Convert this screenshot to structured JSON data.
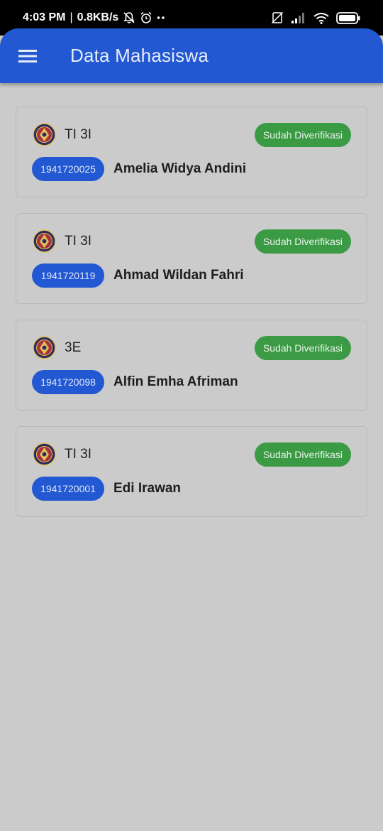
{
  "status_bar": {
    "time": "4:03 PM",
    "speed": "0.8KB/s",
    "icons": [
      "bell-off-icon",
      "alarm-icon",
      "dots-icon",
      "no-sim-icon",
      "signal-icon",
      "wifi-icon",
      "battery-icon"
    ]
  },
  "app_bar": {
    "menu_icon": "hamburger-menu-icon",
    "title": "Data Mahasiswa",
    "color": "#2258d1"
  },
  "students": [
    {
      "kelas": "TI 3I",
      "status": "Sudah Diverifikasi",
      "nim": "1941720025",
      "nama": "Amelia Widya Andini"
    },
    {
      "kelas": "TI 3I",
      "status": "Sudah Diverifikasi",
      "nim": "1941720119",
      "nama": "Ahmad Wildan Fahri"
    },
    {
      "kelas": "3E",
      "status": "Sudah Diverifikasi",
      "nim": "1941720098",
      "nama": "Alfin Emha Afriman"
    },
    {
      "kelas": "TI 3I",
      "status": "Sudah Diverifikasi",
      "nim": "1941720001",
      "nama": "Edi Irawan"
    }
  ],
  "colors": {
    "verified": "#3b9a44",
    "nim_badge": "#2258d1"
  }
}
